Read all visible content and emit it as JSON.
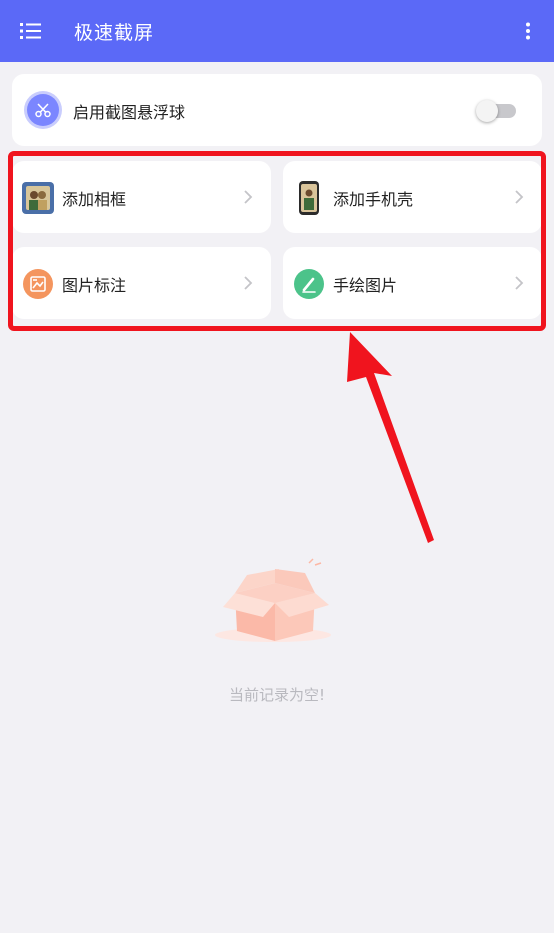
{
  "appbar": {
    "title": "极速截屏",
    "menu_icon": "list-menu-icon",
    "more_icon": "more-vertical-icon",
    "color": "#5b69f7"
  },
  "float_ball": {
    "label": "启用截图悬浮球",
    "icon": "scissors-icon",
    "enabled": false
  },
  "tools": [
    {
      "label": "添加相框",
      "icon": "photo-frame-icon"
    },
    {
      "label": "添加手机壳",
      "icon": "phone-case-icon"
    },
    {
      "label": "图片标注",
      "icon": "image-annotate-icon"
    },
    {
      "label": "手绘图片",
      "icon": "pen-draw-icon"
    }
  ],
  "empty_state": {
    "text": "当前记录为空!"
  },
  "annotation": {
    "highlight_color": "#f0141e"
  }
}
